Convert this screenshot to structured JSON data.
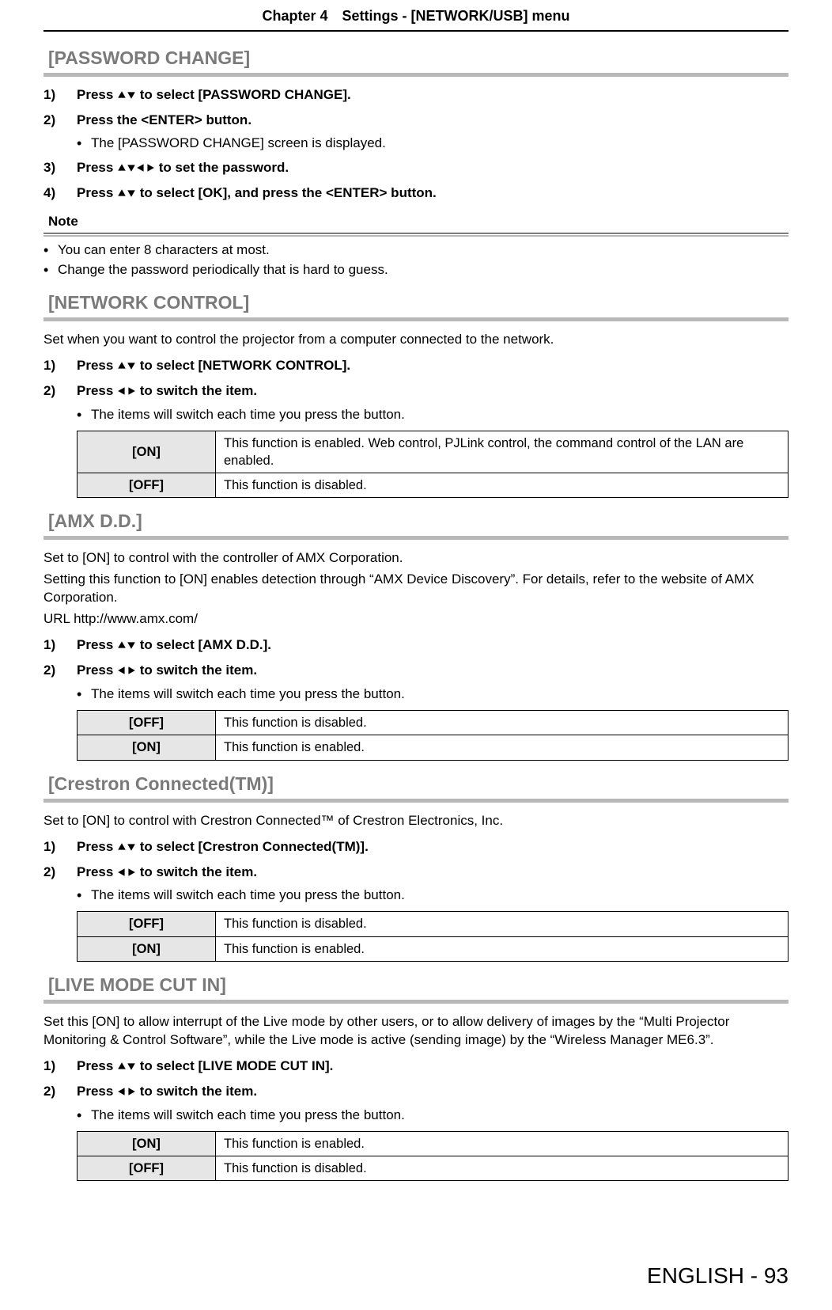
{
  "chapter_header": "Chapter 4 Settings - [NETWORK/USB] menu",
  "sections": {
    "password_change": {
      "title": "[PASSWORD CHANGE]",
      "step1_num": "1)",
      "step1_pre": "Press ",
      "step1_post": " to select [PASSWORD CHANGE].",
      "step2_num": "2)",
      "step2_text": "Press the <ENTER> button.",
      "step2_sub": "The [PASSWORD CHANGE] screen is displayed.",
      "step3_num": "3)",
      "step3_pre": "Press ",
      "step3_post": " to set the password.",
      "step4_num": "4)",
      "step4_pre": "Press ",
      "step4_post": " to select [OK], and press the <ENTER> button.",
      "note_header": "Note",
      "note1": "You can enter 8 characters at most.",
      "note2": "Change the password periodically that is hard to guess."
    },
    "network_control": {
      "title": "[NETWORK CONTROL]",
      "intro": "Set when you want to control the projector from a computer connected to the network.",
      "step1_num": "1)",
      "step1_pre": "Press ",
      "step1_post": " to select [NETWORK CONTROL].",
      "step2_num": "2)",
      "step2_pre": "Press ",
      "step2_post": " to switch the item.",
      "step2_sub": "The items will switch each time you press the button.",
      "row1_key": "[ON]",
      "row1_val": "This function is enabled. Web control, PJLink control, the command control of the LAN are enabled.",
      "row2_key": "[OFF]",
      "row2_val": "This function is disabled."
    },
    "amx": {
      "title": "[AMX D.D.]",
      "intro1": "Set to [ON] to control with the controller of AMX Corporation.",
      "intro2": "Setting this function to [ON] enables detection through “AMX Device Discovery”. For details, refer to the website of AMX Corporation.",
      "intro3": "URL http://www.amx.com/",
      "step1_num": "1)",
      "step1_pre": "Press ",
      "step1_post": " to select [AMX D.D.].",
      "step2_num": "2)",
      "step2_pre": "Press ",
      "step2_post": " to switch the item.",
      "step2_sub": "The items will switch each time you press the button.",
      "row1_key": "[OFF]",
      "row1_val": "This function is disabled.",
      "row2_key": "[ON]",
      "row2_val": "This function is enabled."
    },
    "crestron": {
      "title": "[Crestron Connected(TM)]",
      "intro": "Set to [ON] to control with Crestron Connected™ of Crestron Electronics, Inc.",
      "step1_num": "1)",
      "step1_pre": "Press ",
      "step1_post": " to select [Crestron Connected(TM)].",
      "step2_num": "2)",
      "step2_pre": "Press ",
      "step2_post": " to switch the item.",
      "step2_sub": "The items will switch each time you press the button.",
      "row1_key": "[OFF]",
      "row1_val": "This function is disabled.",
      "row2_key": "[ON]",
      "row2_val": "This function is enabled."
    },
    "live_mode": {
      "title": "[LIVE MODE CUT IN]",
      "intro": "Set this [ON] to allow interrupt of the Live mode by other users, or to allow delivery of images by the “Multi Projector Monitoring & Control Software”, while the Live mode is active (sending image) by the “Wireless Manager ME6.3”.",
      "step1_num": "1)",
      "step1_pre": "Press ",
      "step1_post": " to select [LIVE MODE CUT IN].",
      "step2_num": "2)",
      "step2_pre": "Press ",
      "step2_post": " to switch the item.",
      "step2_sub": "The items will switch each time you press the button.",
      "row1_key": "[ON]",
      "row1_val": "This function is enabled.",
      "row2_key": "[OFF]",
      "row2_val": "This function is disabled."
    }
  },
  "footer": "ENGLISH - 93"
}
